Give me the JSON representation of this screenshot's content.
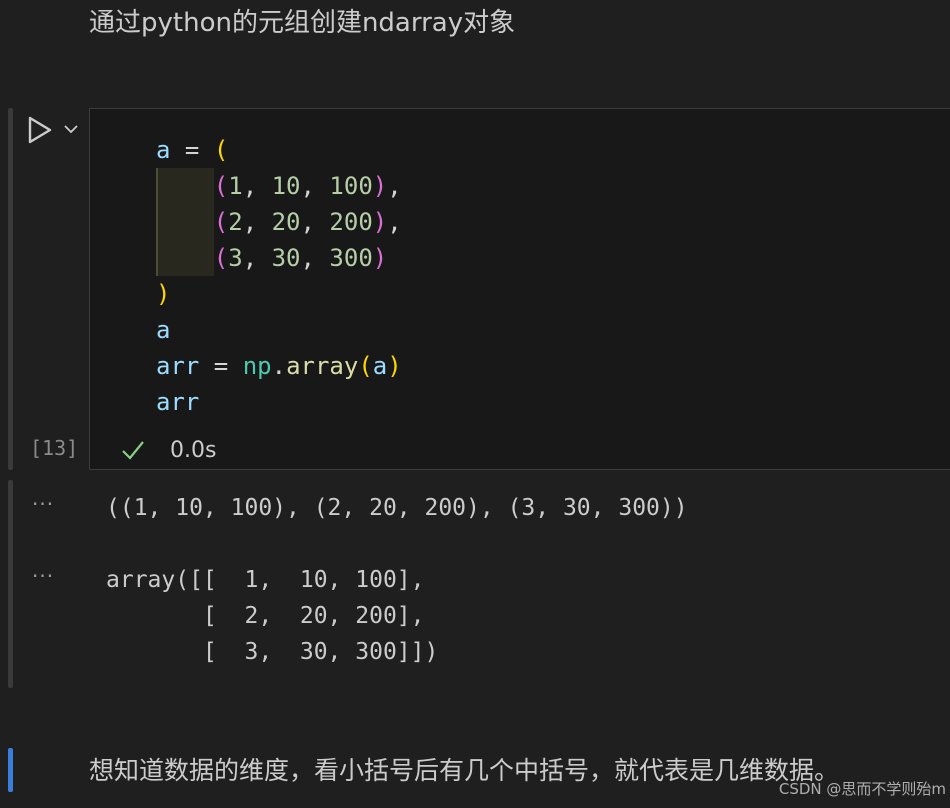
{
  "markdown_top": {
    "text": "通过python的元组创建ndarray对象"
  },
  "cell": {
    "execution_count": "[13]",
    "status_time": "0.0s",
    "icons": {
      "run": "run-icon",
      "more": "chevron-down-icon",
      "status": "check-icon"
    },
    "code_lines": [
      [
        {
          "t": "a",
          "c": "var"
        },
        {
          "t": " = ",
          "c": "op"
        },
        {
          "t": "(",
          "c": "b1"
        }
      ],
      [
        {
          "t": "    ",
          "c": "op"
        },
        {
          "t": "(",
          "c": "b2"
        },
        {
          "t": "1",
          "c": "num"
        },
        {
          "t": ", ",
          "c": "op"
        },
        {
          "t": "10",
          "c": "num"
        },
        {
          "t": ", ",
          "c": "op"
        },
        {
          "t": "100",
          "c": "num"
        },
        {
          "t": ")",
          "c": "b2"
        },
        {
          "t": ",",
          "c": "op"
        }
      ],
      [
        {
          "t": "    ",
          "c": "op"
        },
        {
          "t": "(",
          "c": "b2"
        },
        {
          "t": "2",
          "c": "num"
        },
        {
          "t": ", ",
          "c": "op"
        },
        {
          "t": "20",
          "c": "num"
        },
        {
          "t": ", ",
          "c": "op"
        },
        {
          "t": "200",
          "c": "num"
        },
        {
          "t": ")",
          "c": "b2"
        },
        {
          "t": ",",
          "c": "op"
        }
      ],
      [
        {
          "t": "    ",
          "c": "op"
        },
        {
          "t": "(",
          "c": "b2"
        },
        {
          "t": "3",
          "c": "num"
        },
        {
          "t": ", ",
          "c": "op"
        },
        {
          "t": "30",
          "c": "num"
        },
        {
          "t": ", ",
          "c": "op"
        },
        {
          "t": "300",
          "c": "num"
        },
        {
          "t": ")",
          "c": "b2"
        }
      ],
      [
        {
          "t": ")",
          "c": "b1"
        }
      ],
      [
        {
          "t": "a",
          "c": "var"
        }
      ],
      [
        {
          "t": "arr",
          "c": "var"
        },
        {
          "t": " = ",
          "c": "op"
        },
        {
          "t": "np",
          "c": "mod"
        },
        {
          "t": ".",
          "c": "op"
        },
        {
          "t": "array",
          "c": "fn"
        },
        {
          "t": "(",
          "c": "b1"
        },
        {
          "t": "a",
          "c": "var"
        },
        {
          "t": ")",
          "c": "b1"
        }
      ],
      [
        {
          "t": "arr",
          "c": "var"
        }
      ]
    ]
  },
  "outputs": [
    {
      "menu": "···",
      "text": "((1, 10, 100), (2, 20, 200), (3, 30, 300))"
    },
    {
      "menu": "···",
      "text": "array([[  1,  10, 100],\n       [  2,  20, 200],\n       [  3,  30, 300]])"
    }
  ],
  "markdown_bottom": {
    "text": "想知道数据的维度，看小括号后有几个中括号，就代表是几维数据。"
  },
  "watermark": {
    "text": "CSDN @思而不学则殆m"
  },
  "colors": {
    "background": "#1f1f1f",
    "code_background": "#181818",
    "variable": "#9cdcfe",
    "bracket_level1": "#ffd700",
    "bracket_level2": "#da70d6",
    "number": "#b5cea8",
    "module": "#4ec9b0",
    "function": "#dcdcaa",
    "success": "#89d185",
    "markdown_focus": "#3b7ddd"
  }
}
